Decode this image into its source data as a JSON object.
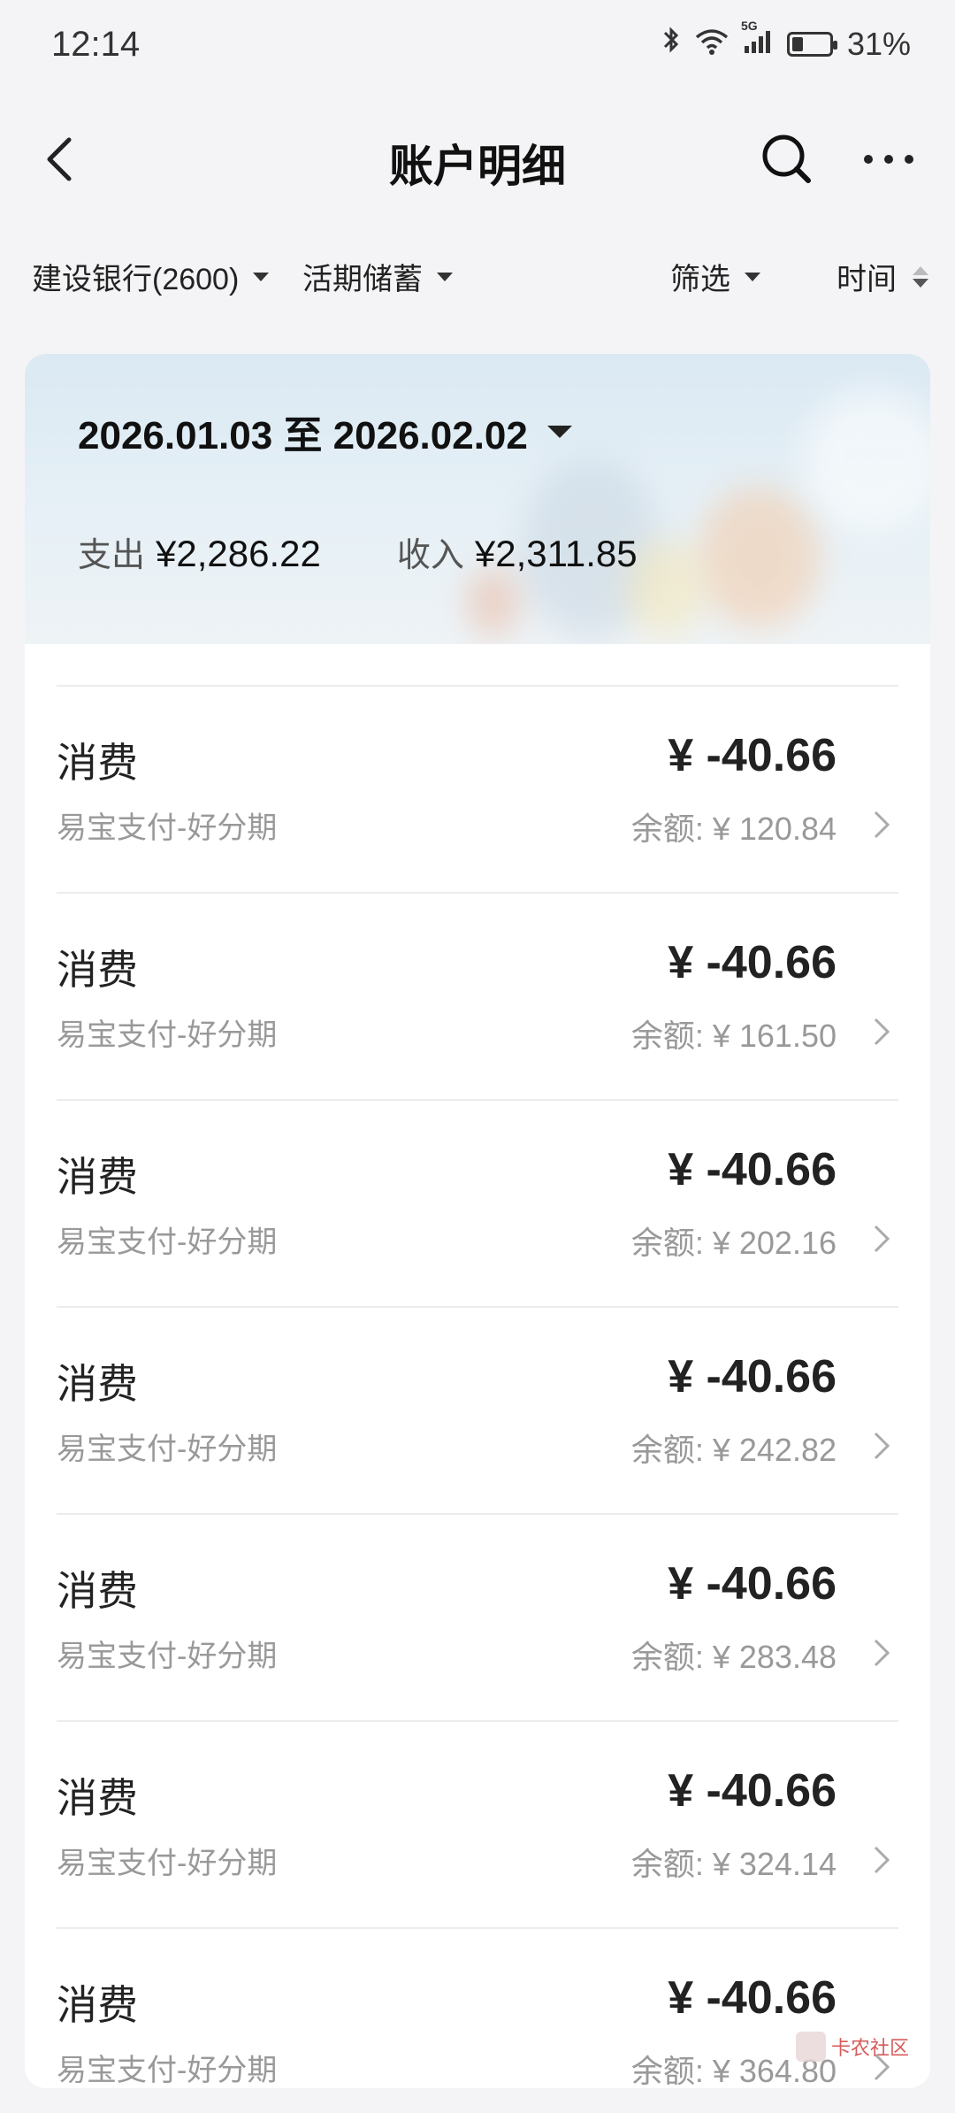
{
  "status_bar": {
    "time": "12:14",
    "network": "5G",
    "battery_percent": "31%",
    "battery_level": 0.31,
    "icons": [
      "bluetooth-icon",
      "wifi-icon",
      "signal-icon",
      "battery-icon"
    ]
  },
  "nav": {
    "title": "账户明细",
    "back_icon": "chevron-left-icon",
    "search_icon": "search-icon",
    "more_icon": "more-horizontal-icon"
  },
  "filters": {
    "account": "建设银行(2600)",
    "account_type": "活期储蓄",
    "filter": "筛选",
    "sort": "时间"
  },
  "summary": {
    "date_range": "2026.01.03 至 2026.02.02",
    "expense_label": "支出",
    "expense_value": "¥2,286.22",
    "income_label": "收入",
    "income_value": "¥2,311.85"
  },
  "transactions": [
    {
      "type": "消费",
      "amount": "¥ -40.66",
      "merchant": "易宝支付-好分期",
      "balance": "余额: ¥ 120.84"
    },
    {
      "type": "消费",
      "amount": "¥ -40.66",
      "merchant": "易宝支付-好分期",
      "balance": "余额: ¥ 161.50"
    },
    {
      "type": "消费",
      "amount": "¥ -40.66",
      "merchant": "易宝支付-好分期",
      "balance": "余额: ¥ 202.16"
    },
    {
      "type": "消费",
      "amount": "¥ -40.66",
      "merchant": "易宝支付-好分期",
      "balance": "余额: ¥ 242.82"
    },
    {
      "type": "消费",
      "amount": "¥ -40.66",
      "merchant": "易宝支付-好分期",
      "balance": "余额: ¥ 283.48"
    },
    {
      "type": "消费",
      "amount": "¥ -40.66",
      "merchant": "易宝支付-好分期",
      "balance": "余额: ¥ 324.14"
    },
    {
      "type": "消费",
      "amount": "¥ -40.66",
      "merchant": "易宝支付-好分期",
      "balance": "余额: ¥ 364.80"
    }
  ],
  "watermark": "卡农社区",
  "colors": {
    "background": "#f4f4f6",
    "card": "#ffffff",
    "banner": "#dbe9f3",
    "primary_text": "#222222",
    "secondary_text": "#999999"
  }
}
